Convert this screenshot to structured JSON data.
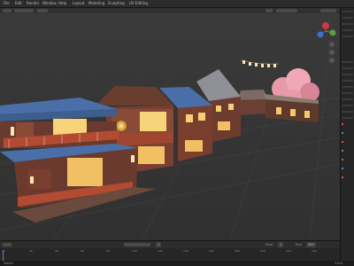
{
  "app": {
    "name": "Blender"
  },
  "menu": [
    "File",
    "Edit",
    "Render",
    "Window",
    "Help",
    "Layout",
    "Modeling",
    "Sculpting",
    "UV Editing"
  ],
  "viewport": {
    "mode": "Object Mode",
    "shading": "Solid"
  },
  "timeline": {
    "current_frame": "1",
    "start_label": "Start",
    "start": "1",
    "end_label": "End",
    "end": "250",
    "ruler": [
      "0",
      "20",
      "40",
      "60",
      "80",
      "100",
      "120",
      "140",
      "160",
      "180",
      "200",
      "220",
      "240"
    ]
  },
  "status": {
    "left": "Select",
    "right": "3.6.0"
  },
  "colors": {
    "accent": "#e8a23a",
    "viewport_bg": "#3a3a3a",
    "sakura": "#e89aa8",
    "roof_blue": "#4a6fa8"
  }
}
